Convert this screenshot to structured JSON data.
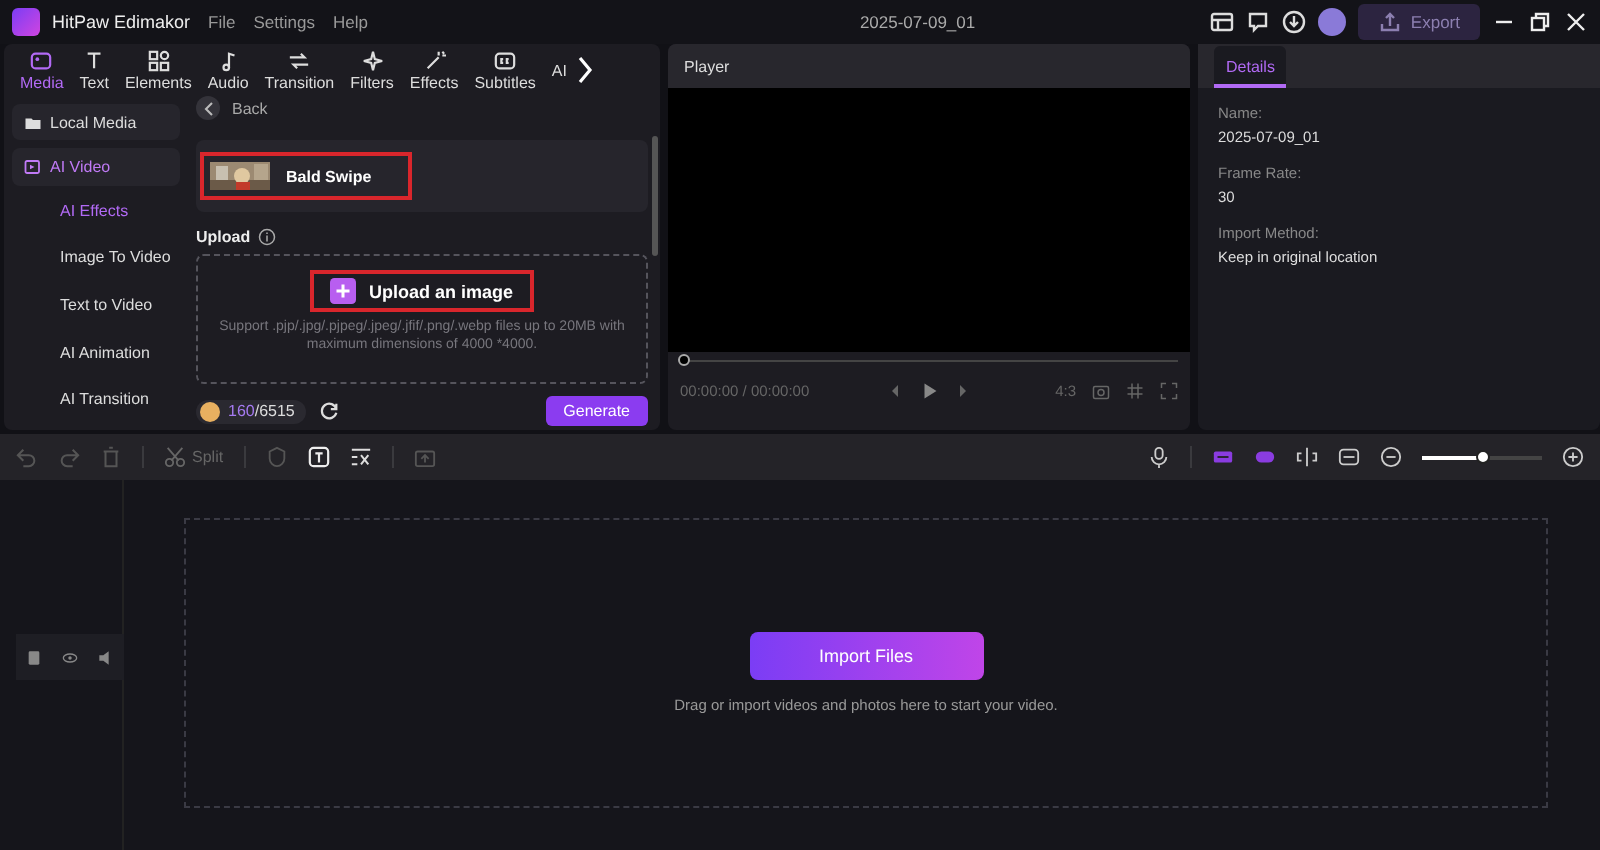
{
  "app": {
    "title": "HitPaw Edimakor",
    "menu": [
      "File",
      "Settings",
      "Help"
    ],
    "project": "2025-07-09_01",
    "export": "Export"
  },
  "tabs": [
    {
      "label": "Media",
      "selected": true
    },
    {
      "label": "Text",
      "selected": false
    },
    {
      "label": "Elements",
      "selected": false
    },
    {
      "label": "Audio",
      "selected": false
    },
    {
      "label": "Transition",
      "selected": false
    },
    {
      "label": "Filters",
      "selected": false
    },
    {
      "label": "Effects",
      "selected": false
    },
    {
      "label": "Subtitles",
      "selected": false
    },
    {
      "label": "AI",
      "selected": false
    }
  ],
  "sidebar": [
    {
      "label": "Local Media",
      "selected": false
    },
    {
      "label": "AI Video",
      "selected": true,
      "children": [
        {
          "label": "AI Effects",
          "selected": true
        },
        {
          "label": "Image To Video",
          "selected": false
        },
        {
          "label": "Text to Video",
          "selected": false
        },
        {
          "label": "AI Animation",
          "selected": false
        },
        {
          "label": "AI Transition",
          "selected": false
        }
      ]
    }
  ],
  "back": "Back",
  "effect": {
    "title": "Bald Swipe",
    "highlighted": true
  },
  "upload": {
    "label": "Upload",
    "button": "Upload an image",
    "highlighted": true,
    "hint": "Support .pjp/.jpg/.pjpeg/.jpeg/.jfif/.png/.webp files up to 20MB with maximum dimensions of 4000 *4000."
  },
  "credits": {
    "used": "160",
    "total": "/6515"
  },
  "generate": "Generate",
  "player": {
    "title": "Player",
    "time": "00:00:00 / 00:00:00",
    "ratio": "4:3",
    "level": 0
  },
  "details": {
    "tab": "Details",
    "fields": [
      {
        "label": "Name:",
        "value": "2025-07-09_01"
      },
      {
        "label": "Frame Rate:",
        "value": "30"
      },
      {
        "label": "Import Method:",
        "value": "Keep in original location"
      }
    ]
  },
  "toolbar": {
    "split": "Split",
    "zoom": {
      "level": 0.5
    }
  },
  "timeline": {
    "button": "Import Files",
    "hint": "Drag or import videos and photos here to start your video."
  }
}
